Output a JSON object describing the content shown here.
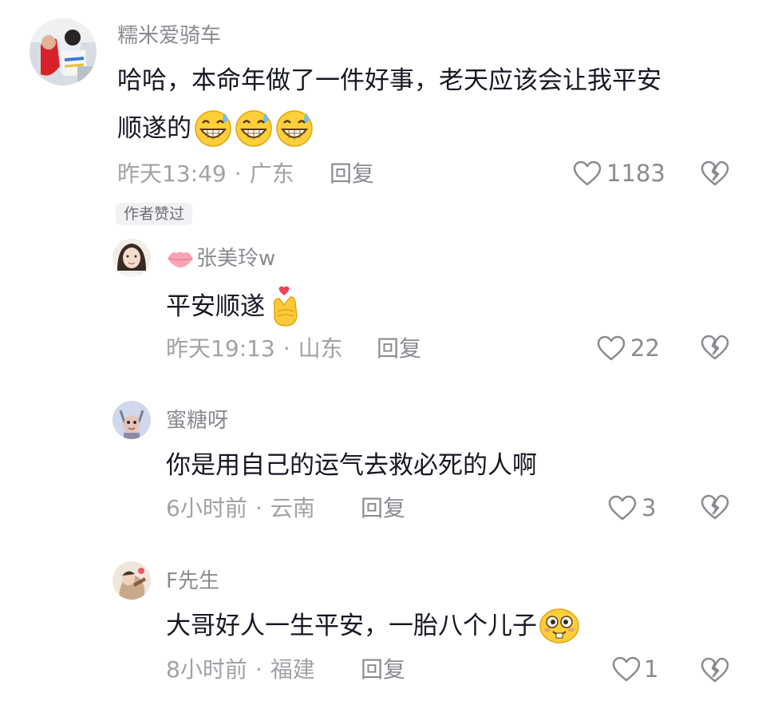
{
  "comments": [
    {
      "username": "糯米爱骑车",
      "text_line1": "哈哈，本命年做了一件好事，老天应该会让我平安",
      "text_line2": "顺遂的",
      "emojis": "grinning-sweat-emoji x3",
      "time": "昨天13:49",
      "location": "广东",
      "reply_label": "回复",
      "likes": "1183",
      "badge": "作者赞过"
    },
    {
      "username": "张美玲w",
      "text": "平安顺遂",
      "emoji": "finger-heart-emoji",
      "time": "昨天19:13",
      "location": "山东",
      "reply_label": "回复",
      "likes": "22"
    },
    {
      "username": "蜜糖呀",
      "text": "你是用自己的运气去救必死的人啊",
      "time": "6小时前",
      "location": "云南",
      "reply_label": "回复",
      "likes": "3"
    },
    {
      "username": "F先生",
      "text": "大哥好人一生平安，一胎八个儿子",
      "emoji": "goofy-face-emoji",
      "time": "8小时前",
      "location": "福建",
      "reply_label": "回复",
      "likes": "1"
    }
  ],
  "separator": "·",
  "colors": {
    "text": "#161823",
    "secondary": "#8a8b91",
    "meta": "#a1a2a7",
    "lips_icon": "#f7a5b5"
  }
}
